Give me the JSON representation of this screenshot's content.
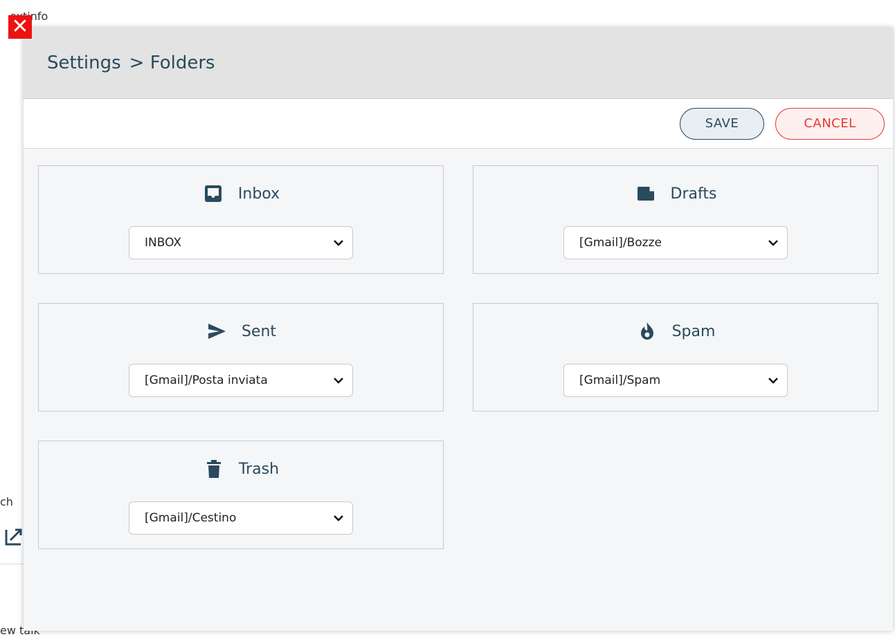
{
  "background": {
    "top_text": "extinfo",
    "left_mid_text": "ch",
    "bottom_text": "ew talk"
  },
  "modal": {
    "breadcrumb": {
      "root": "Settings",
      "current": "> Folders"
    },
    "toolbar": {
      "save_label": "SAVE",
      "cancel_label": "CANCEL"
    },
    "folders": [
      {
        "title": "Inbox",
        "icon": "inbox-icon",
        "value": "INBOX"
      },
      {
        "title": "Drafts",
        "icon": "drafts-icon",
        "value": "[Gmail]/Bozze"
      },
      {
        "title": "Sent",
        "icon": "send-icon",
        "value": "[Gmail]/Posta inviata"
      },
      {
        "title": "Spam",
        "icon": "fire-icon",
        "value": "[Gmail]/Spam"
      },
      {
        "title": "Trash",
        "icon": "trash-icon",
        "value": "[Gmail]/Cestino"
      }
    ]
  },
  "colors": {
    "primary": "#2a4a5e",
    "danger": "#e53935",
    "close": "#ee1111"
  }
}
